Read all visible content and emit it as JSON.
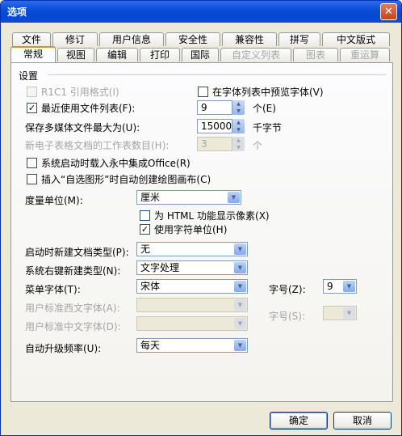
{
  "window": {
    "title": "选项",
    "close_glyph": "✕"
  },
  "tabs_row1": [
    "文件",
    "修订",
    "用户信息",
    "安全性",
    "兼容性",
    "拼写",
    "中文版式"
  ],
  "tabs_row2": [
    "常规",
    "视图",
    "编辑",
    "打印",
    "国际",
    "自定义列表",
    "图表",
    "重运算"
  ],
  "settings": {
    "group_label": "设置",
    "r1c1": {
      "label": "R1C1 引用格式(I)",
      "checked": false,
      "enabled": false
    },
    "preview_fonts": {
      "label": "在字体列表中预览字体(V)",
      "checked": false
    },
    "recent_files": {
      "label": "最近使用文件列表(F):",
      "checked": true,
      "value": "9",
      "unit": "个(E)"
    },
    "max_media": {
      "label": "保存多媒体文件最大为(U):",
      "value": "15000",
      "unit": "千字节"
    },
    "new_sheets": {
      "label": "新电子表格文档的工作表数目(H):",
      "value": "3",
      "unit": "个",
      "enabled": false
    },
    "startup_office": {
      "label": "系统启动时载入永中集成Office(R)",
      "checked": false
    },
    "autoshape_canvas": {
      "label": "插入“自选图形”时自动创建绘图画布(C)",
      "checked": false
    },
    "measure_unit": {
      "label": "度量单位(M):",
      "value": "厘米"
    },
    "html_pixels": {
      "label": "为 HTML 功能显示像素(X)",
      "checked": false
    },
    "char_unit": {
      "label": "使用字符单位(H)",
      "checked": true
    },
    "startup_doc_type": {
      "label": "启动时新建文档类型(P):",
      "value": "无"
    },
    "rightclick_type": {
      "label": "系统右键新建类型(N):",
      "value": "文字处理"
    },
    "menu_font": {
      "label": "菜单字体(T):",
      "value": "宋体",
      "size_label": "字号(Z):",
      "size_value": "9"
    },
    "western_font": {
      "label": "用户标准西文字体(A):",
      "value": "",
      "size_label": "字号(S):",
      "size_value": "",
      "enabled": false
    },
    "chinese_font": {
      "label": "用户标准中文字体(D):",
      "value": "",
      "enabled": false
    },
    "auto_upgrade": {
      "label": "自动升级频率(U):",
      "value": "每天"
    }
  },
  "buttons": {
    "ok": "确定",
    "cancel": "取消"
  },
  "icons": {
    "checkmark": "✓",
    "dropdown": "▼",
    "spin_up": "▲",
    "spin_down": "▼"
  },
  "colors": {
    "title_bar": "#0a4ed8",
    "active_tab_accent": "#e68b2c",
    "dialog_bg": "#ece9d8"
  }
}
